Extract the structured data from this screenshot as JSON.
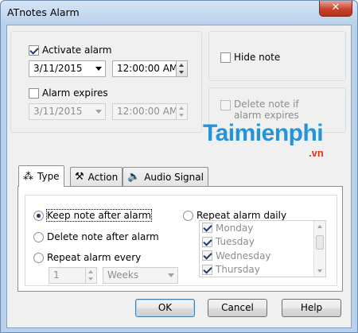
{
  "window": {
    "title": "ATnotes Alarm",
    "close_glyph": "✕"
  },
  "alarm": {
    "activate_label": "Activate alarm",
    "activate_checked": true,
    "date": "3/11/2015",
    "time": "12:00:00 AM",
    "expires_label": "Alarm expires",
    "expires_checked": false,
    "expires_date": "3/11/2015",
    "expires_time": "12:00:00 AM"
  },
  "options": {
    "hide_note_label": "Hide note",
    "delete_expires_label": "Delete note if alarm expires"
  },
  "tabs": [
    {
      "label": "Type",
      "icon": "bell-sound-icon",
      "active": true
    },
    {
      "label": "Action",
      "icon": "tools-icon",
      "active": false
    },
    {
      "label": "Audio Signal",
      "icon": "speaker-icon",
      "active": false
    }
  ],
  "type_tab": {
    "keep_note_label": "Keep note after alarm",
    "delete_note_label": "Delete note after alarm",
    "repeat_every_label": "Repeat alarm every",
    "repeat_every_value": "1",
    "repeat_unit": "Weeks",
    "repeat_daily_label": "Repeat alarm daily",
    "selected_option": "keep_note",
    "days": [
      {
        "label": "Monday",
        "checked": true
      },
      {
        "label": "Tuesday",
        "checked": true
      },
      {
        "label": "Wednesday",
        "checked": true
      },
      {
        "label": "Thursday",
        "checked": true
      }
    ]
  },
  "buttons": {
    "ok": "OK",
    "cancel": "Cancel",
    "help": "Help"
  },
  "watermark": {
    "brand": "Taimienphi",
    "suffix": ".vn"
  }
}
